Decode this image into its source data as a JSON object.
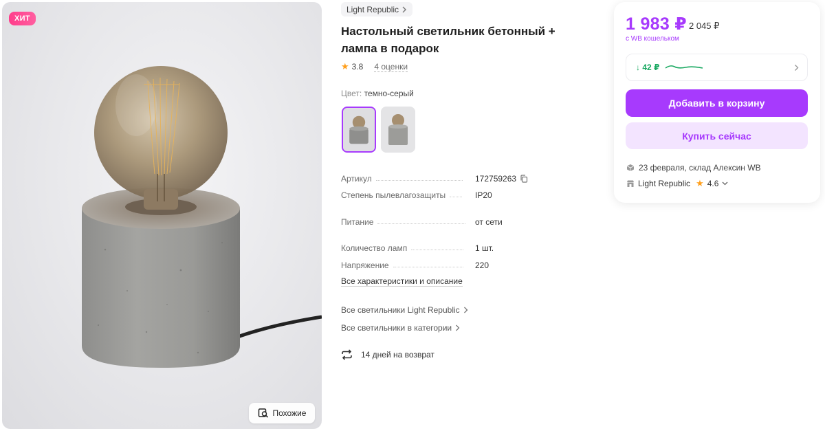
{
  "gallery": {
    "badge": "ХИТ",
    "similar_label": "Похожие"
  },
  "product": {
    "brand": "Light Republic",
    "title_line1": "Настольный светильник бетонный +",
    "title_line2": "лампа в подарок",
    "rating": "3.8",
    "reviews": "4 оценки",
    "color_label": "Цвет:",
    "color_value": "темно-серый"
  },
  "specs": [
    {
      "key": "Артикул",
      "value": "172759263"
    },
    {
      "key": "Степень пылевлагозащиты",
      "value": "IP20"
    },
    {
      "key": "Питание",
      "value": "от сети"
    },
    {
      "key": "Количество ламп",
      "value": "1 шт."
    },
    {
      "key": "Напряжение",
      "value": "220"
    }
  ],
  "links": {
    "all_specs": "Все характеристики и описание",
    "all_brand": "Все светильники Light Republic",
    "all_category": "Все светильники в категории",
    "returns": "14 дней на возврат"
  },
  "price_card": {
    "price": "1 983 ₽",
    "old_price": "2 045 ₽",
    "wallet_note": "с WB кошельком",
    "history_drop": "↓ 42 ₽",
    "add_to_cart": "Добавить в корзину",
    "buy_now": "Купить сейчас",
    "delivery": "23 февраля, склад Алексин WB",
    "seller": "Light Republic",
    "seller_rating": "4.6"
  },
  "colors": {
    "accent": "#a73afd",
    "accent_light": "#f3e4ff",
    "badge": "#ff3d8b",
    "drop_green": "#18a860",
    "star": "#ff9f1c"
  }
}
